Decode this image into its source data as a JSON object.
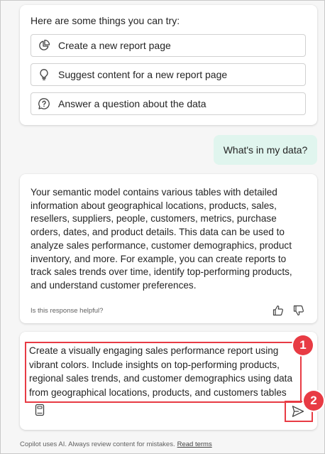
{
  "suggestions": {
    "heading": "Here are some things you can try:",
    "items": [
      {
        "label": "Create a new report page",
        "icon": "pie-chart-icon"
      },
      {
        "label": "Suggest content for a new report page",
        "icon": "lightbulb-icon"
      },
      {
        "label": "Answer a question about the data",
        "icon": "chat-question-icon"
      }
    ]
  },
  "user_message": {
    "text": "What's in my data?"
  },
  "response": {
    "text": "Your semantic model contains various tables with detailed information about geographical locations, products, sales, resellers, suppliers, people, customers, metrics, purchase orders, dates, and product details. This data can be used to analyze sales performance, customer demographics, product inventory, and more. For example, you can create reports to track sales trends over time, identify top-performing products, and understand customer preferences.",
    "helpful_label": "Is this response helpful?",
    "icons": [
      "thumbs-up-icon",
      "thumbs-down-icon"
    ]
  },
  "composer": {
    "value": "Create a visually engaging sales performance report using vibrant colors. Include insights on top-performing products, regional sales trends, and customer demographics using data from geographical locations, products, and customers tables",
    "icons": [
      "notebook-icon",
      "send-icon"
    ]
  },
  "annotations": {
    "badge_1": "1",
    "badge_2": "2",
    "highlight_color": "#e83b44"
  },
  "footer": {
    "disclaimer": "Copilot uses AI. Always review content for mistakes.",
    "link": "Read terms"
  },
  "colors": {
    "user_bubble": "#e0f5ee",
    "background": "#f6f6f6",
    "card": "#ffffff"
  }
}
